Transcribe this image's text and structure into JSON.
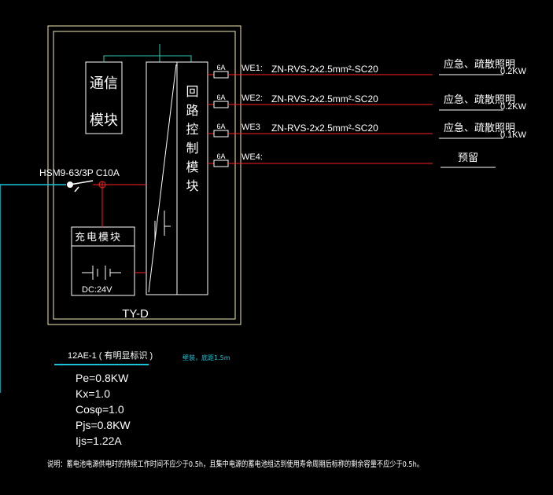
{
  "panel": {
    "name": "TY-D",
    "comm_module": [
      "通信",
      "模块"
    ],
    "loop_module": "回路控制模块",
    "charge_module": "充电模块",
    "dc_label": "DC:24V",
    "breaker": "HSM9-63/3P C10A"
  },
  "circuits": [
    {
      "fuse": "6A",
      "id": "WE1:",
      "cable": "ZN-RVS-2x2.5mm²-SC20",
      "load": "应急、疏散照明",
      "power": "0.2KW"
    },
    {
      "fuse": "6A",
      "id": "WE2:",
      "cable": "ZN-RVS-2x2.5mm²-SC20",
      "load": "应急、疏散照明",
      "power": "0.2KW"
    },
    {
      "fuse": "6A",
      "id": "WE3",
      "cable": "ZN-RVS-2x2.5mm²-SC20",
      "load": "应急、疏散照明",
      "power": "0.1KW"
    },
    {
      "fuse": "6A",
      "id": "WE4:",
      "cable": "",
      "load": "预留",
      "power": ""
    }
  ],
  "panel_tag": "12AE-1 ( 有明显标识 )",
  "install_note": "壁装，底距1.5m",
  "params": [
    "Pe=0.8KW",
    "Kx=1.0",
    "Cosφ=1.0",
    "Pjs=0.8KW",
    "Ijs=1.22A"
  ],
  "note": "说明：蓄电池电源供电时的持续工作时间不应少于0.5h，且集中电源的蓄电池组达到使用寿命周期后标称的剩余容量不应少于0.5h。",
  "colors": {
    "wire": "#ff2020",
    "feed": "#19c4d8",
    "green": "#2ec8b0",
    "frame": "#f3e9b0"
  }
}
